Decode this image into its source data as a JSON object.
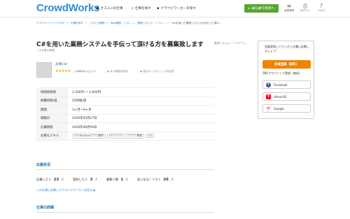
{
  "header": {
    "logo": "CrowdWorks",
    "nav": [
      {
        "icon": "lightbulb-icon",
        "glyph": "●",
        "label": "オススメの仕事"
      },
      {
        "icon": "search-icon",
        "glyph": "⌕",
        "label": "仕事を探す"
      },
      {
        "icon": "users-icon",
        "glyph": "▪",
        "label": "クラウドワーカーを探す"
      }
    ],
    "cta": "はじめての方へ",
    "icons": [
      {
        "name": "bell-icon",
        "glyph": "≡",
        "label": "会員登録"
      },
      {
        "name": "login-icon",
        "glyph": "⎙",
        "label": "ログイン"
      },
      {
        "name": "help-icon",
        "glyph": "?",
        "label": "ヘルプ"
      }
    ]
  },
  "breadcrumb": [
    "クラウドソーシングTOP",
    "仕事を探す",
    "システム開発",
    "Web開発・シス…",
    "業務システム・ソフト…",
    "C#を用いた業務システムを手伝って頂け…"
  ],
  "job": {
    "title": "C#を用いた業務システムを手伝って頂ける方を募集致します",
    "category": "業務システム・ソフトウェ…",
    "subtitle": "この仕事の情報"
  },
  "client": {
    "name": "高橋CW",
    "rating": 5,
    "stars": "★★★★★",
    "reviews": "(10件のレビュー)",
    "identity": "本人確認未提出",
    "order_check": "発注ルールチェック未回答"
  },
  "details": [
    {
      "key": "時間単価制",
      "value": "1,500円 〜 2,000円"
    },
    {
      "key": "稼働時間/週",
      "value": "20時間/週"
    },
    {
      "key": "期間",
      "value": "3ヶ月〜6ヶ月"
    },
    {
      "key": "掲載日",
      "value": "2020年05月27日"
    },
    {
      "key": "応募期限",
      "value": "2020年06月09日"
    }
  ],
  "skills": {
    "key": "必要なスキル",
    "tags": [
      "C# Windowsアプリ開発",
      "C# デスクトップアプリ開発",
      "C#"
    ]
  },
  "applications": {
    "heading": "応募状況",
    "applicants_label": "応募した人",
    "applicants": "23",
    "applicants_unit": "人",
    "contracted_label": "契約した人",
    "contracted": "3",
    "contracted_unit": "人",
    "hires_label": "募集人数",
    "hires": "1",
    "hires_unit": "人",
    "watch_label": "気になる！リスト",
    "watch": "26",
    "watch_unit": "人",
    "link": "この仕事に応募したクラウドワーカーを見る ▶"
  },
  "description": {
    "heading": "仕事の詳細"
  },
  "sidebar": {
    "prompt": "会員登録してさっそく仕事に応募しましょう！",
    "register": "会員登録（無料）",
    "sns_label": "SNSアカウントで登録（無料）",
    "facebook": "Facebook",
    "yahoo": "Yahoo!ID",
    "google": "Google",
    "colors": {
      "facebook": "#3b5998",
      "yahoo": "#ff0033",
      "google": "#ea4335"
    }
  }
}
